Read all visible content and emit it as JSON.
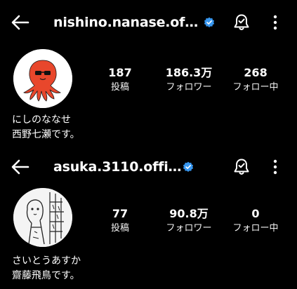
{
  "profiles": [
    {
      "username": "nishino.nanase.offic…",
      "stats": [
        {
          "value": "187",
          "label": "投稿"
        },
        {
          "value": "186.3万",
          "label": "フォロワー"
        },
        {
          "value": "268",
          "label": "フォロー中"
        }
      ],
      "bio_line1": "にしのななせ",
      "bio_line2": "西野七瀬です。"
    },
    {
      "username": "asuka.3110.official",
      "stats": [
        {
          "value": "77",
          "label": "投稿"
        },
        {
          "value": "90.8万",
          "label": "フォロワー"
        },
        {
          "value": "0",
          "label": "フォロー中"
        }
      ],
      "bio_line1": "さいとうあすか",
      "bio_line2": "齋藤飛鳥です。"
    }
  ],
  "colors": {
    "background": "#000000",
    "text": "#ffffff",
    "verified_badge": "#3897f0",
    "octopus_avatar": "#e8472c"
  },
  "icons": [
    "back-arrow-icon",
    "verified-badge-icon",
    "notification-bell-icon",
    "more-options-icon"
  ]
}
